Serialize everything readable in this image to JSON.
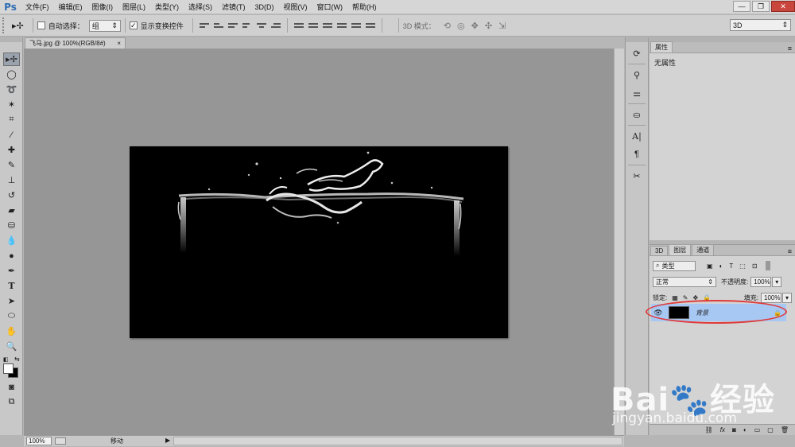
{
  "app": {
    "logo": "Ps"
  },
  "menu": [
    "文件(F)",
    "编辑(E)",
    "图像(I)",
    "图层(L)",
    "类型(Y)",
    "选择(S)",
    "滤镜(T)",
    "3D(D)",
    "视图(V)",
    "窗口(W)",
    "帮助(H)"
  ],
  "window_controls": {
    "minimize": "—",
    "restore": "❐",
    "close": "✕"
  },
  "options": {
    "auto_select_label": "自动选择：",
    "auto_select_value": "组",
    "show_transform_label": "显示变换控件",
    "show_transform_checked": "✓",
    "mode_label": "3D 模式：",
    "workspace_value": "3D"
  },
  "document": {
    "tab_title": "飞马.jpg @ 100%(RGB/8#)",
    "tab_close": "×"
  },
  "status": {
    "zoom": "100%",
    "tool_name": "移动",
    "arrow": "▶"
  },
  "properties": {
    "tab_label": "属性",
    "content": "无属性"
  },
  "layers_panel": {
    "tabs": [
      "3D",
      "图层",
      "通道"
    ],
    "filter_label": "类型",
    "blend_mode": "正常",
    "opacity_label": "不透明度:",
    "opacity_value": "100%",
    "lock_label": "锁定:",
    "fill_label": "填充:",
    "fill_value": "100%",
    "layer": {
      "name": "背景"
    }
  },
  "watermark": {
    "logo": "Bai🐾经验",
    "url": "jingyan.baidu.com"
  },
  "colors": {
    "accent": "#a8c8f4",
    "highlight": "#e03a3a",
    "canvas": "#969696"
  }
}
